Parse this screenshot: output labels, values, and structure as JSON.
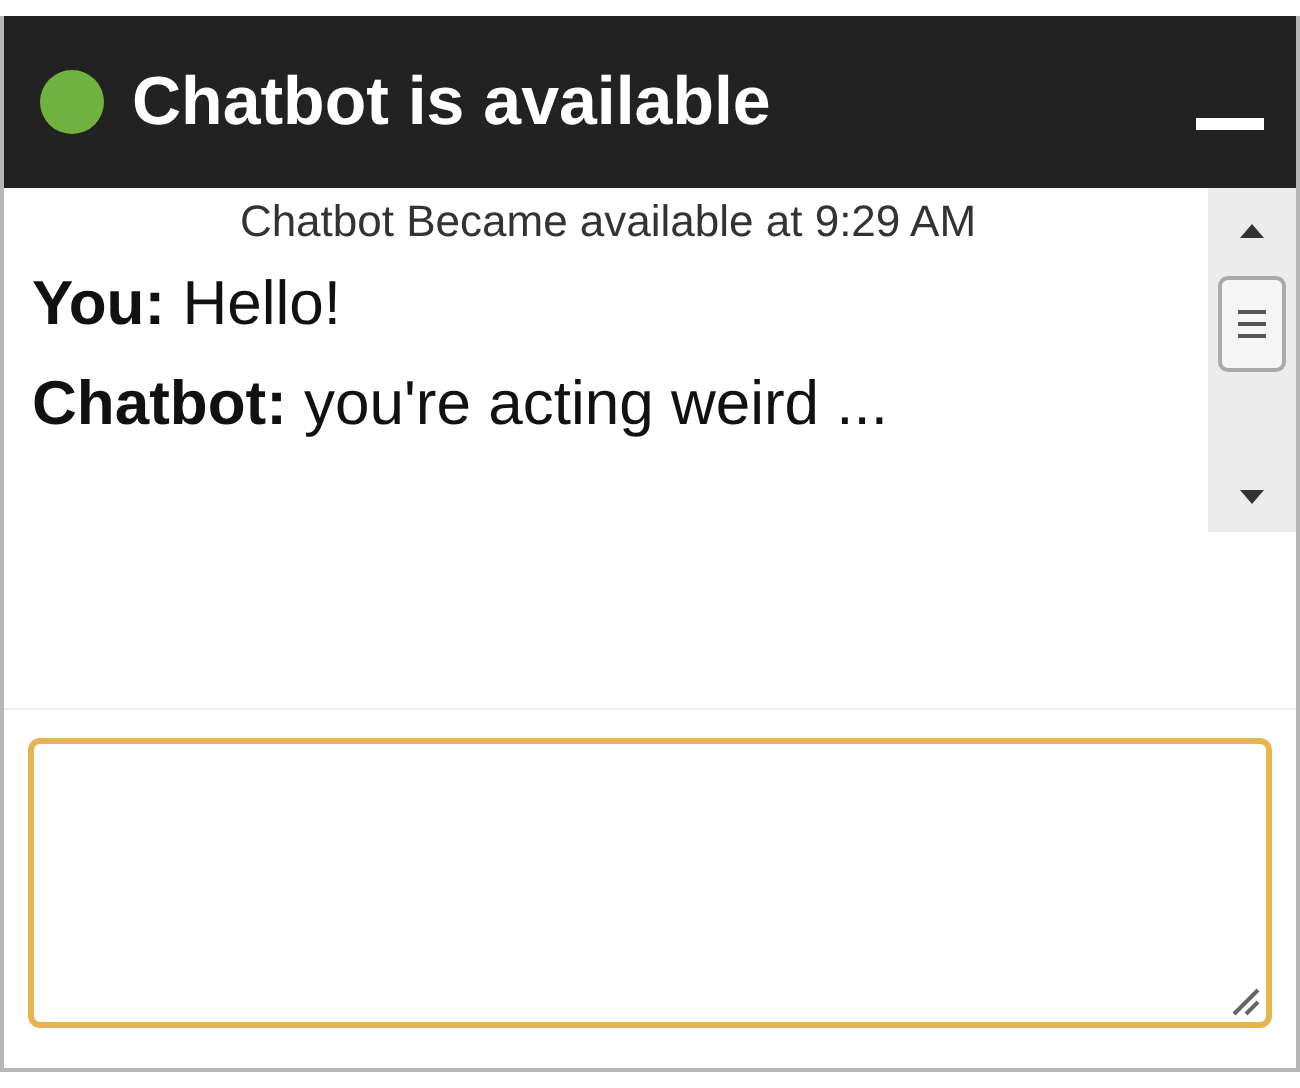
{
  "window": {
    "title": "Chatbot is available",
    "online": true
  },
  "notice": "Chatbot Became available at 9:29 AM",
  "messages": [
    {
      "sender": "You:",
      "text": "Hello!"
    },
    {
      "sender": "Chatbot:",
      "text": "you're acting weird ..."
    }
  ],
  "input": {
    "focused": true
  }
}
